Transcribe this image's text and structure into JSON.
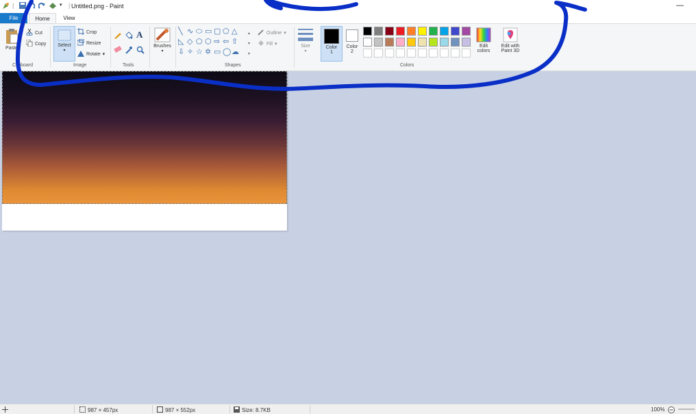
{
  "titlebar": {
    "title": "Untitled.png - Paint",
    "qa_dropdown": "▾"
  },
  "tabs": {
    "file": "File",
    "home": "Home",
    "view": "View"
  },
  "clipboard": {
    "paste": "Paste",
    "cut": "Cut",
    "copy": "Copy",
    "group": "Clipboard"
  },
  "image": {
    "select": "Select",
    "crop": "Crop",
    "resize": "Resize",
    "rotate": "Rotate",
    "group": "Image"
  },
  "tools": {
    "group": "Tools"
  },
  "brushes": {
    "label": "Brushes"
  },
  "shapes": {
    "outline": "Outline",
    "fill": "Fill",
    "group": "Shapes"
  },
  "size": {
    "label": "Size"
  },
  "colors": {
    "color1_label": "Color",
    "color1_num": "1",
    "color2_label": "Color",
    "color2_num": "2",
    "edit_colors_1": "Edit",
    "edit_colors_2": "colors",
    "edit3d_1": "Edit with",
    "edit3d_2": "Paint 3D",
    "group": "Colors",
    "color1_value": "#000000",
    "color2_value": "#ffffff",
    "palette_row1": [
      "#000000",
      "#7f7f7f",
      "#880015",
      "#ed1c24",
      "#ff7f27",
      "#fff200",
      "#22b14c",
      "#00a2e8",
      "#3f48cc",
      "#a349a4"
    ],
    "palette_row2": [
      "#ffffff",
      "#c3c3c3",
      "#b97a57",
      "#ffaec9",
      "#ffc90e",
      "#efe4b0",
      "#b5e61d",
      "#99d9ea",
      "#7092be",
      "#c8bfe7"
    ]
  },
  "status": {
    "selection_size": "987 × 457px",
    "image_size": "987 × 552px",
    "file_size": "Size: 8.7KB",
    "zoom": "100%"
  },
  "accent": "#1979ca",
  "annotation_color": "#0a2fc7"
}
